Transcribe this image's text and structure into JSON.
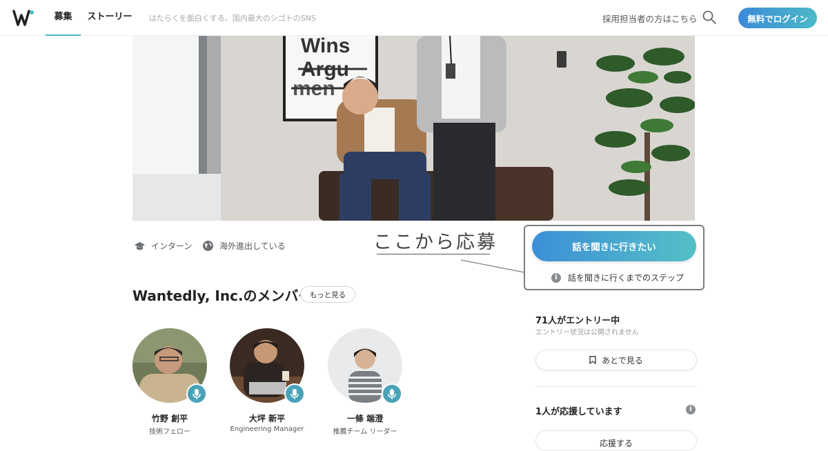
{
  "header": {
    "nav": [
      {
        "label": "募集",
        "active": true
      },
      {
        "label": "ストーリー",
        "active": false
      }
    ],
    "tagline": "はたらくを面白くする、国内最大のシゴトのSNS",
    "recruiter_link": "採用担当者の方はこちら",
    "search_icon": "search-icon",
    "login_button": "無料でログイン",
    "accent_color": "#4cb9c8"
  },
  "hero": {
    "poster_lines": [
      "Wins",
      "Argu",
      "men"
    ]
  },
  "tags": [
    {
      "icon": "graduation-cap-icon",
      "label": "インターン"
    },
    {
      "icon": "globe-icon",
      "label": "海外進出している"
    }
  ],
  "annotation": {
    "text": "ここから応募"
  },
  "apply": {
    "button_label": "話を聞きに行きたい",
    "steps_label": "話を聞きに行くまでのステップ"
  },
  "members": {
    "title": "Wantedly, Inc.のメンバー",
    "more_label": "もっと見る",
    "list": [
      {
        "name": "竹野 創平",
        "role": "技術フェロー"
      },
      {
        "name": "大坪 新平",
        "role": "Engineering Manager"
      },
      {
        "name": "一條 端澄",
        "role": "推薦チーム リーダー"
      }
    ]
  },
  "sidebar": {
    "entry_count": "71人がエントリー中",
    "entry_note": "エントリー状況は公開されません",
    "later_label": "あとで見る",
    "support_count": "1人が応援しています",
    "cheer_label": "応援する"
  }
}
